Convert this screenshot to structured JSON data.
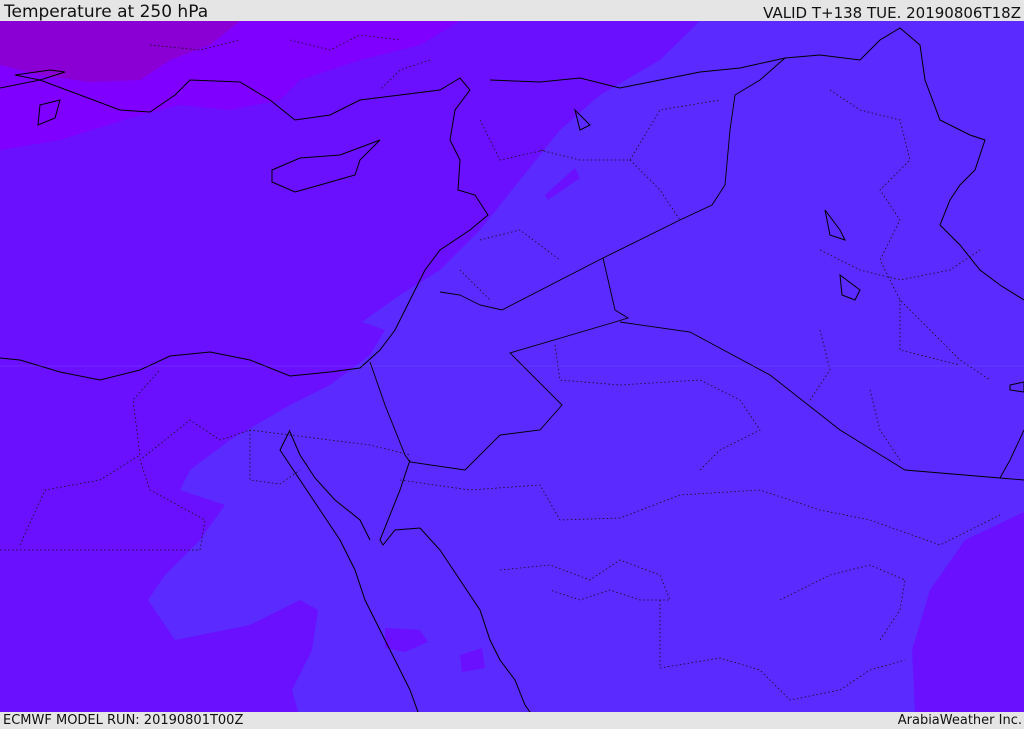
{
  "header": {
    "title": "Temperature at 250 hPa",
    "valid_time": "VALID T+138 TUE. 20190806T18Z"
  },
  "footer": {
    "model_run": "ECMWF MODEL RUN: 20190801T00Z",
    "brand": "ArabiaWeather Inc."
  },
  "map": {
    "variable": "Temperature",
    "level": "250 hPa",
    "colors": {
      "coldest": "#8a00d4",
      "cold": "#8000ff",
      "mid": "#6a10ff",
      "warm": "#5a2aff",
      "coastline": "#000000"
    }
  }
}
